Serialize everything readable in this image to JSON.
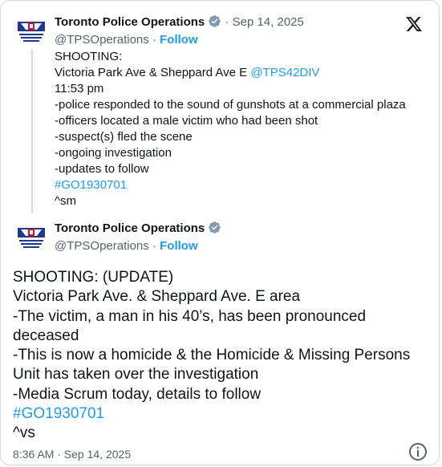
{
  "first_tweet": {
    "author_name": "Toronto Police Operations",
    "date": "Sep 14, 2025",
    "handle": "@TPSOperations",
    "follow_label": "Follow",
    "lines": [
      "SHOOTING:",
      "Victoria Park Ave & Sheppard Ave E",
      "11:53 pm",
      "-police responded to the sound of gunshots at a commercial plaza",
      "-officers located a male victim who had been shot",
      "-suspect(s) fled the scene",
      "-ongoing investigation",
      "-updates to follow"
    ],
    "mention": "@TPS42DIV",
    "hashtag": "#GO1930701",
    "signoff": "^sm"
  },
  "second_tweet": {
    "author_name": "Toronto Police Operations",
    "handle": "@TPSOperations",
    "follow_label": "Follow",
    "lines": [
      "SHOOTING: (UPDATE)",
      "Victoria Park Ave. & Sheppard Ave. E area",
      "-The victim, a man in his 40’s, has been pronounced deceased",
      "-This is now a homicide & the Homicide & Missing Persons Unit has taken over the investigation",
      "-Media Scrum today, details to follow"
    ],
    "hashtag": "#GO1930701",
    "signoff": "^vs",
    "timestamp": "8:36 AM · Sep 14, 2025"
  },
  "icons": {
    "verified": "verified-badge-icon",
    "x_logo": "x-logo-icon",
    "info": "info-icon",
    "avatar": "toronto-police-logo"
  },
  "colors": {
    "link": "#1d9bf0",
    "muted": "#536471",
    "text": "#0f1419",
    "verified_badge": "#829aab"
  }
}
